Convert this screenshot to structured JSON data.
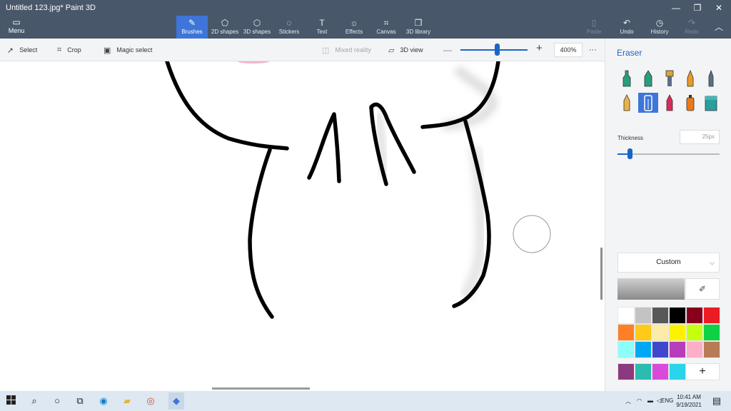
{
  "titlebar": {
    "title": "Untitled 123.jpg*   Paint 3D",
    "minimize": "—",
    "maximize": "❐",
    "close": "✕"
  },
  "ribbon": {
    "menu_label": "Menu",
    "tools": [
      {
        "label": "Brushes",
        "icon": "brush-icon"
      },
      {
        "label": "2D shapes",
        "icon": "2d-shapes-icon"
      },
      {
        "label": "3D shapes",
        "icon": "3d-shapes-icon"
      },
      {
        "label": "Stickers",
        "icon": "stickers-icon"
      },
      {
        "label": "Text",
        "icon": "text-icon"
      },
      {
        "label": "Effects",
        "icon": "effects-icon"
      },
      {
        "label": "Canvas",
        "icon": "canvas-icon"
      },
      {
        "label": "3D library",
        "icon": "3d-library-icon"
      }
    ],
    "actions": [
      {
        "label": "Paste",
        "icon": "paste-icon",
        "enabled": false
      },
      {
        "label": "Undo",
        "icon": "undo-icon",
        "enabled": true
      },
      {
        "label": "History",
        "icon": "history-icon",
        "enabled": true
      },
      {
        "label": "Redo",
        "icon": "redo-icon",
        "enabled": false
      }
    ]
  },
  "subbar": {
    "select": "Select",
    "crop": "Crop",
    "magic_select": "Magic select",
    "mixed_reality": "Mixed reality",
    "view_3d": "3D view",
    "zoom_value": "400%",
    "zoom_level": 0.54,
    "more": "···"
  },
  "panel": {
    "title": "Eraser",
    "brushes": [
      {
        "name": "marker-icon",
        "color": "#2a9d7f"
      },
      {
        "name": "calligraphy-pen-icon",
        "color": "#2a9d7f"
      },
      {
        "name": "oil-brush-icon",
        "color": "#d9a43a"
      },
      {
        "name": "watercolor-icon",
        "color": "#e89a2a"
      },
      {
        "name": "pixel-pen-icon",
        "color": "#5f6e86"
      },
      {
        "name": "pencil-icon",
        "color": "#e8b34a"
      },
      {
        "name": "eraser-icon",
        "color": "#ffffff"
      },
      {
        "name": "crayon-icon",
        "color": "#d92b58"
      },
      {
        "name": "spray-can-icon",
        "color": "#e87a1a"
      },
      {
        "name": "fill-icon",
        "color": "#2a9d9d"
      }
    ],
    "thickness_label": "Thickness",
    "thickness_value": "25px",
    "thickness_level": 0.12,
    "color_dropdown": "Custom",
    "current_color": "#a8a8a8",
    "palette": [
      "#ffffff",
      "#c3c3c3",
      "#585858",
      "#000000",
      "#88001b",
      "#ec1c24",
      "#ff7f27",
      "#ffca18",
      "#fdeca6",
      "#fff200",
      "#c4ff0e",
      "#0ed145",
      "#8cfffb",
      "#00a8f3",
      "#3f48cc",
      "#b83dba",
      "#ffaec8",
      "#b97a56"
    ],
    "custom_colors": [
      "#8b3a7d",
      "#2bbbb0",
      "#d94ad8",
      "#2ad4ea"
    ],
    "add_color": "+"
  },
  "taskbar": {
    "lang": "ENG",
    "time": "10:41 AM",
    "date": "9/19/2021"
  },
  "colors": {
    "accent": "#3e75d8",
    "ribbon_bg": "#49576b",
    "panel_bg": "#f3f4f6"
  }
}
